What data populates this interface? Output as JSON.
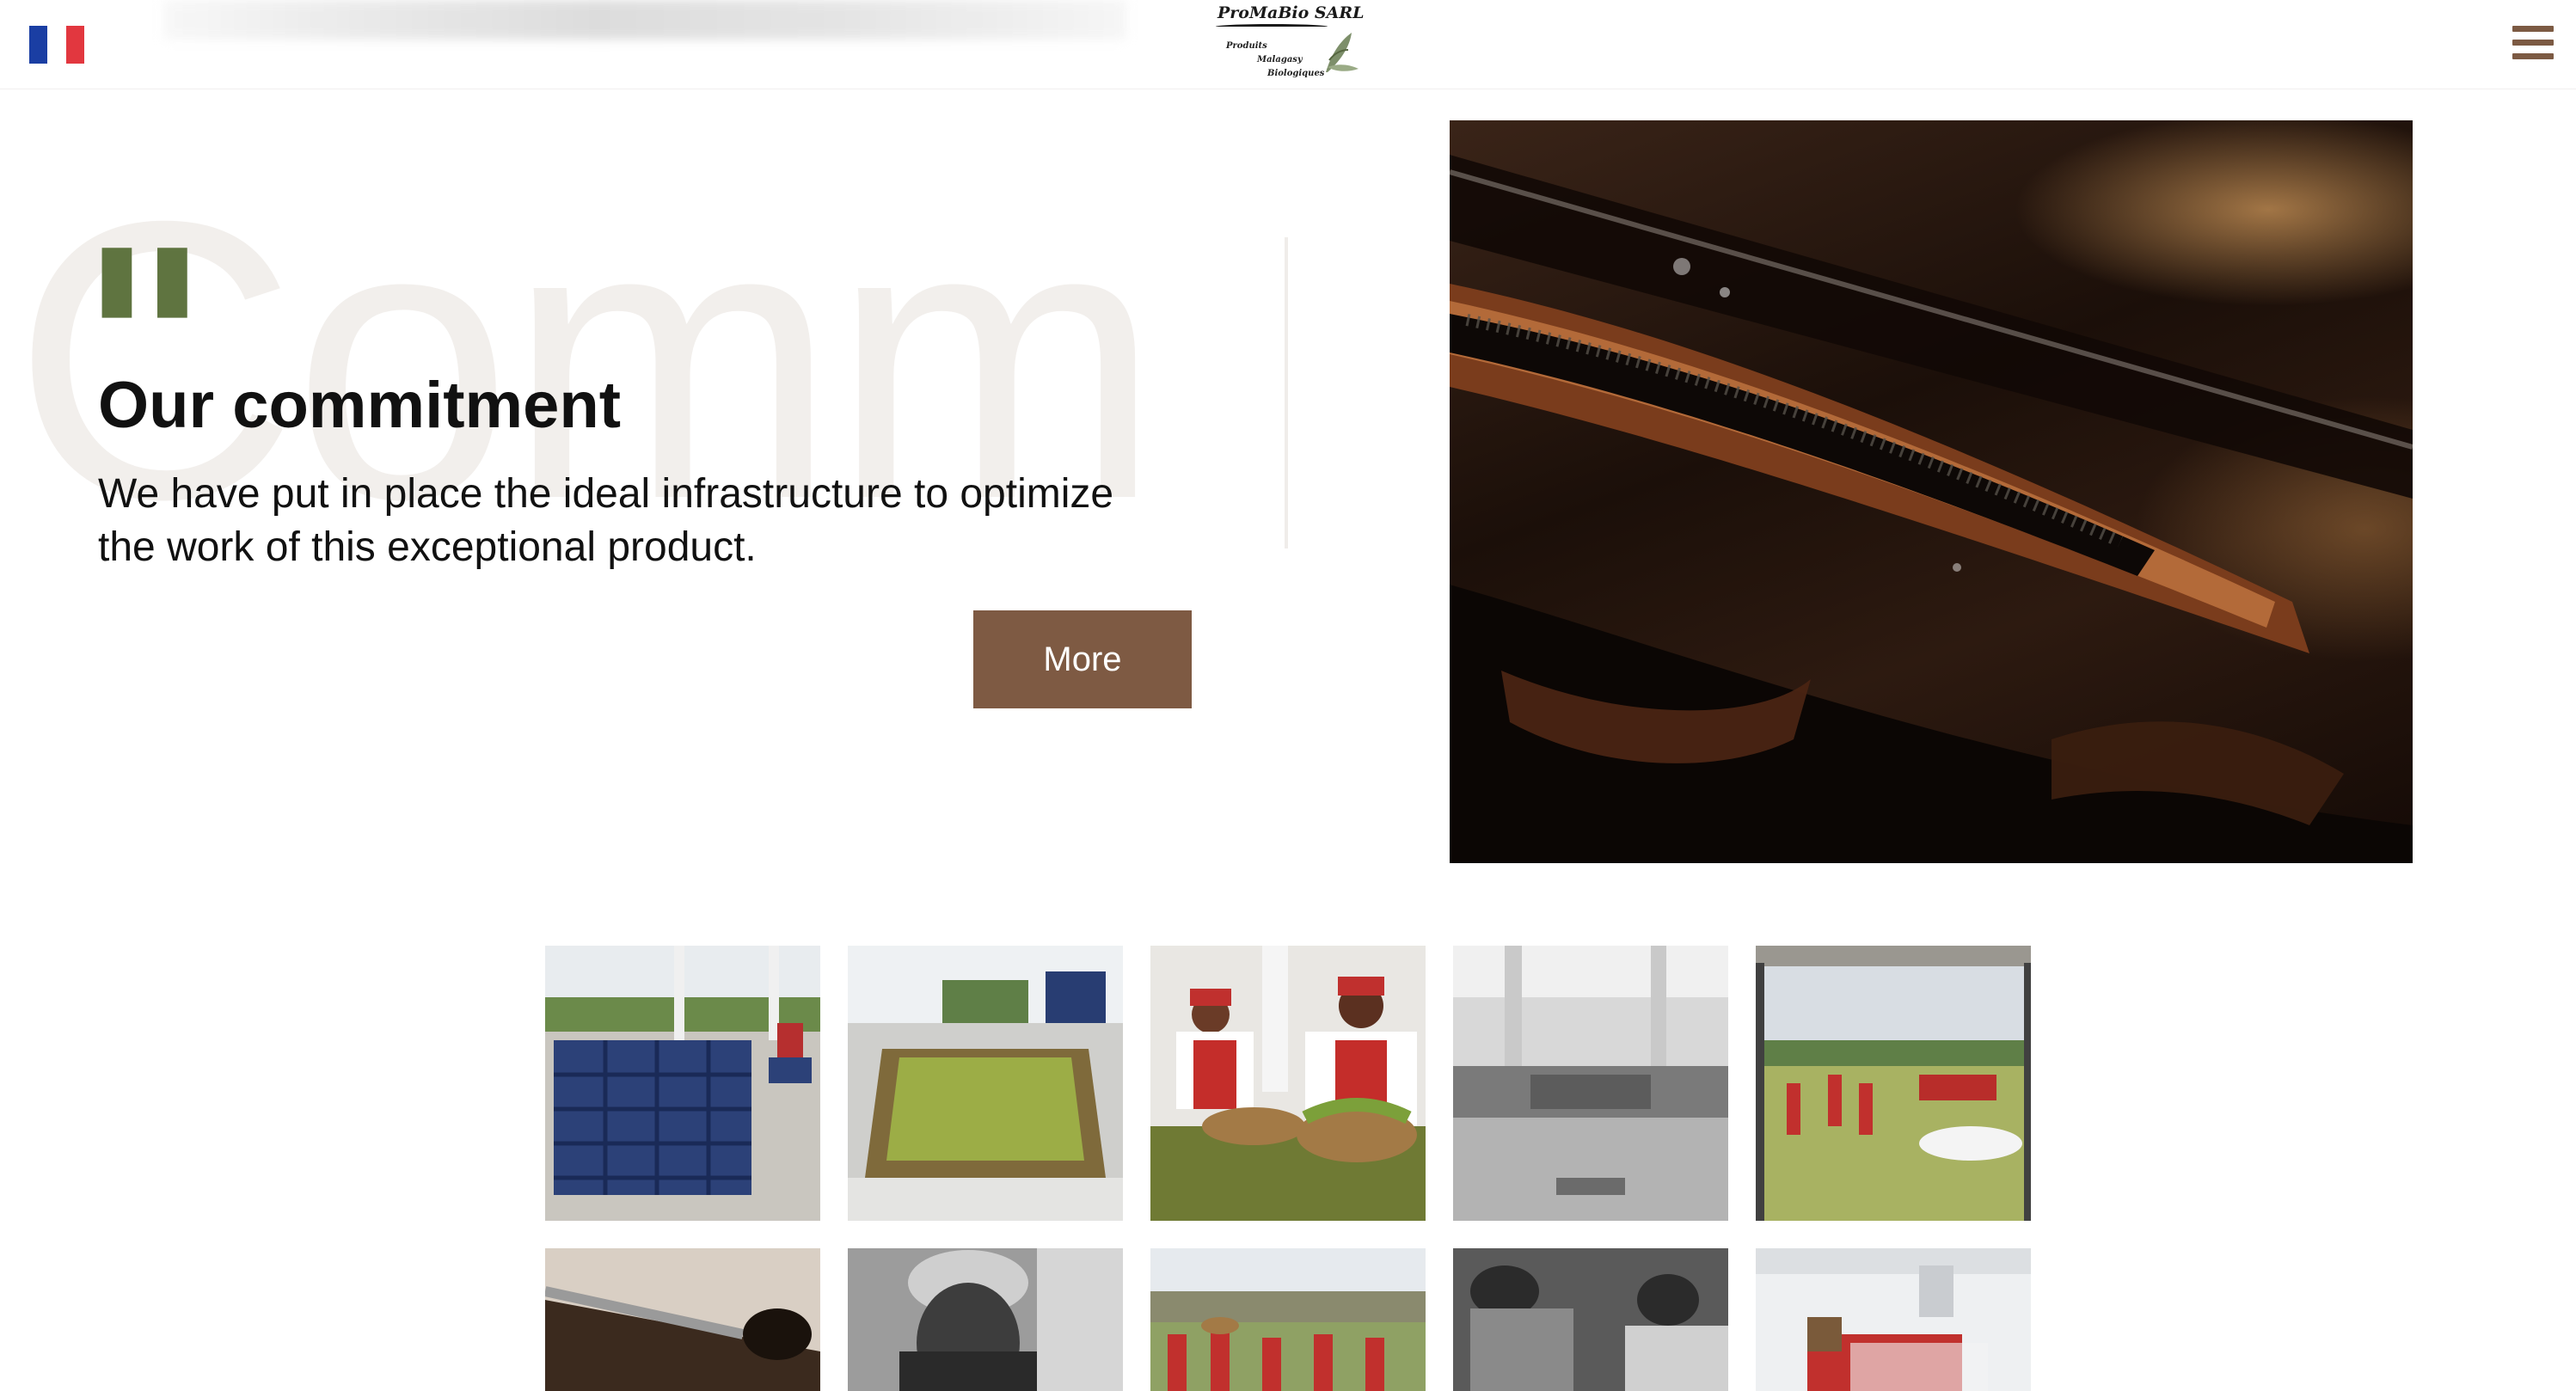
{
  "header": {
    "language_flag": "france-flag",
    "flag_colors": [
      "#1a3ea3",
      "#ffffff",
      "#e2373f"
    ],
    "logo": {
      "title": "ProMaBio SARL",
      "line1": "Produits",
      "line2": "Malagasy",
      "line3": "Biologiques"
    },
    "menu_icon": "hamburger-menu-icon"
  },
  "section": {
    "background_word": "Comm",
    "quote_mark": "\"",
    "title": "Our commitment",
    "description": "We have put in place the ideal infrastructure to optimize the work of this exceptional product.",
    "button_label": "More"
  },
  "colors": {
    "accent_brown": "#7e5a43",
    "quote_green": "#5f7440",
    "text": "#111111"
  },
  "gallery": {
    "row1": [
      "vanilla-crates-photo",
      "vanilla-washing-tables-photo",
      "workers-sorting-vanilla-photo",
      "warehouse-interior-photo",
      "drying-field-photo"
    ],
    "row2": [
      "vanilla-pod-closeup-photo",
      "elderly-man-portrait-photo",
      "workers-carrying-baskets-photo",
      "workers-at-table-photo",
      "workers-in-hall-photo"
    ]
  }
}
